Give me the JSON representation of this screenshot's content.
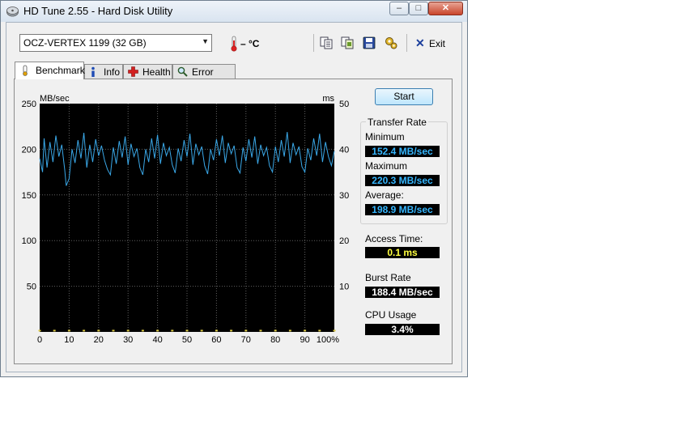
{
  "window": {
    "title": "HD Tune 2.55 - Hard Disk Utility",
    "min_glyph": "–",
    "max_glyph": "□",
    "close_glyph": "✕"
  },
  "toolbar": {
    "drive": "OCZ-VERTEX 1199 (32 GB)",
    "temperature": "– °C",
    "exit_label": "Exit"
  },
  "tabs": [
    {
      "label": "Benchmark"
    },
    {
      "label": "Info"
    },
    {
      "label": "Health"
    },
    {
      "label": "Error Scan"
    }
  ],
  "benchmark": {
    "start_label": "Start",
    "transfer_rate_title": "Transfer Rate",
    "minimum_label": "Minimum",
    "minimum_value": "152.4 MB/sec",
    "maximum_label": "Maximum",
    "maximum_value": "220.3 MB/sec",
    "average_label": "Average:",
    "average_value": "198.9 MB/sec",
    "access_time_label": "Access Time:",
    "access_time_value": "0.1 ms",
    "burst_rate_label": "Burst Rate",
    "burst_rate_value": "188.4 MB/sec",
    "cpu_usage_label": "CPU Usage",
    "cpu_usage_value": "3.4%"
  },
  "colors": {
    "transfer_line": "#3aa8e8",
    "access_points": "#d8c640",
    "value_blue": "#35b6ff",
    "value_yellow": "#ffff40",
    "value_white": "#ffffff",
    "plot_bg": "#000000",
    "grid": "#606060"
  },
  "chart_data": {
    "type": "line",
    "ylabel_left": "MB/sec",
    "ylabel_right": "ms",
    "x_ticks": [
      "0",
      "10",
      "20",
      "30",
      "40",
      "50",
      "60",
      "70",
      "80",
      "90",
      "100%"
    ],
    "y_left_ticks": [
      "50",
      "100",
      "150",
      "200",
      "250"
    ],
    "y_right_ticks": [
      "10",
      "20",
      "30",
      "40",
      "50"
    ],
    "xlim": [
      0,
      100
    ],
    "ylim_left": [
      0,
      250
    ],
    "ylim_right": [
      0,
      50
    ],
    "grid": true,
    "series": [
      {
        "axis": "left",
        "x": [
          0,
          1,
          1.5,
          2.5,
          3.5,
          4.5,
          5.5,
          6.5,
          7.5,
          8.5,
          9,
          10,
          11,
          12,
          13,
          14,
          15,
          16,
          17,
          18,
          19,
          20,
          21,
          22,
          23,
          24,
          25,
          26,
          27,
          28,
          29,
          30,
          31,
          32,
          33,
          34,
          35,
          36,
          37,
          38,
          39,
          40,
          41,
          42,
          43,
          44,
          45,
          46,
          47,
          48,
          49,
          50,
          51,
          52,
          53,
          54,
          55,
          56,
          57,
          58,
          59,
          60,
          61,
          62,
          63,
          64,
          65,
          66,
          67,
          68,
          69,
          70,
          71,
          72,
          73,
          74,
          75,
          76,
          77,
          78,
          79,
          80,
          81,
          82,
          83,
          84,
          85,
          86,
          87,
          88,
          89,
          90,
          91,
          92,
          93,
          94,
          95,
          96,
          97,
          98,
          99,
          100
        ],
        "y": [
          190,
          175,
          212,
          180,
          208,
          186,
          215,
          192,
          205,
          178,
          160,
          168,
          200,
          185,
          210,
          190,
          218,
          180,
          205,
          186,
          211,
          193,
          204,
          188,
          178,
          172,
          202,
          184,
          209,
          191,
          214,
          183,
          206,
          192,
          201,
          180,
          172,
          200,
          186,
          212,
          190,
          216,
          184,
          207,
          193,
          202,
          183,
          174,
          201,
          187,
          210,
          192,
          217,
          183,
          206,
          194,
          203,
          182,
          173,
          200,
          188,
          211,
          193,
          215,
          185,
          207,
          195,
          204,
          180,
          174,
          202,
          187,
          211,
          191,
          214,
          184,
          205,
          193,
          202,
          182,
          175,
          203,
          186,
          210,
          192,
          219,
          185,
          207,
          194,
          203,
          181,
          175,
          201,
          188,
          212,
          193,
          217,
          186,
          208,
          192,
          182,
          198
        ]
      },
      {
        "axis": "right",
        "x": [
          0,
          5,
          10,
          15,
          20,
          25,
          30,
          35,
          40,
          45,
          50,
          55,
          60,
          65,
          70,
          75,
          80,
          85,
          90,
          95,
          100
        ],
        "y": [
          0.1,
          0.1,
          0.1,
          0.1,
          0.1,
          0.1,
          0.1,
          0.1,
          0.1,
          0.1,
          0.1,
          0.1,
          0.1,
          0.1,
          0.1,
          0.1,
          0.1,
          0.1,
          0.1,
          0.1,
          0.1
        ]
      }
    ]
  }
}
